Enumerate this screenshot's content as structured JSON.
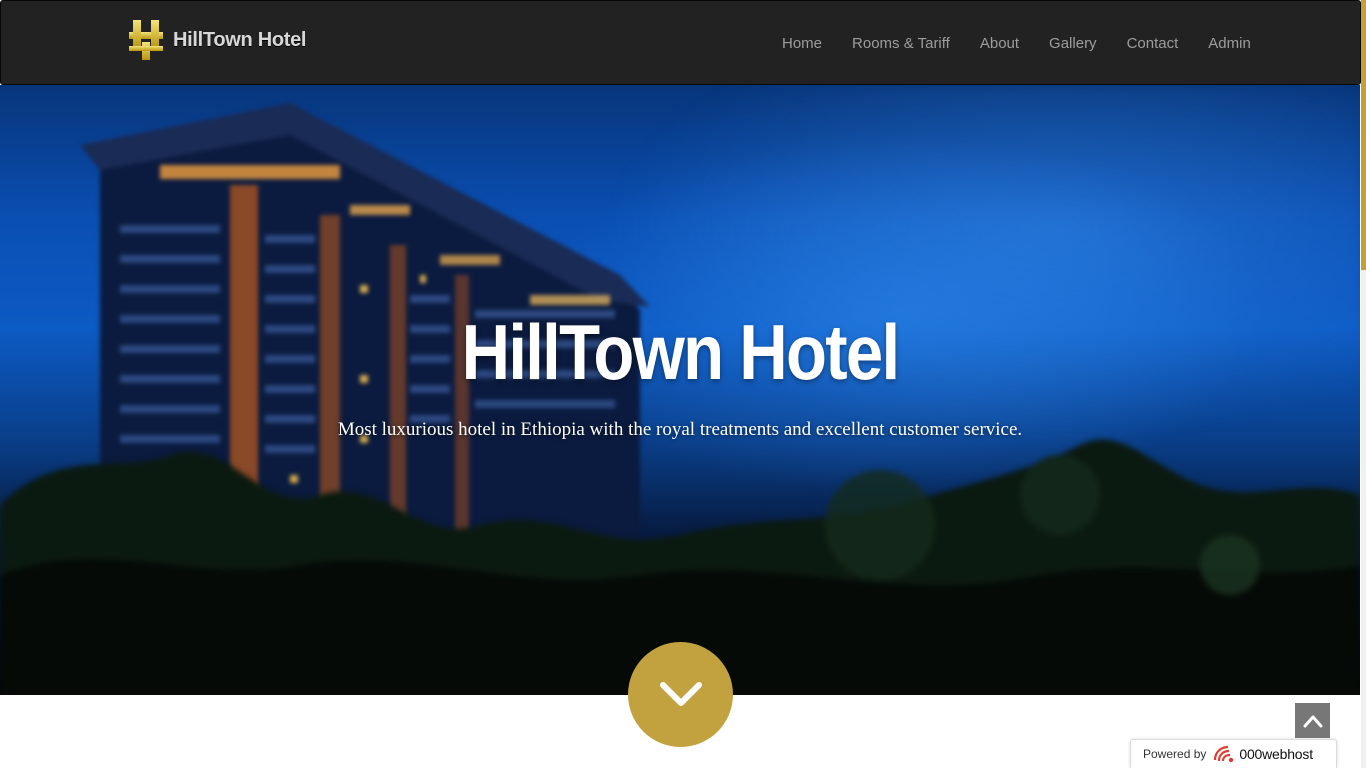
{
  "navbar": {
    "brand": "HillTown Hotel",
    "brand_logo_icon": "hotel-logo-icon",
    "links": [
      {
        "label": "Home"
      },
      {
        "label": "Rooms & Tariff"
      },
      {
        "label": "About"
      },
      {
        "label": "Gallery"
      },
      {
        "label": "Contact"
      },
      {
        "label": "Admin"
      }
    ]
  },
  "hero": {
    "title": "HillTown Hotel",
    "subtitle": "Most luxurious hotel in Ethiopia with the royal treatments and excellent customer service.",
    "scroll_icon": "chevron-down-icon"
  },
  "back_to_top_icon": "chevron-up-icon",
  "powered": {
    "label": "Powered by",
    "brand": "000webhost"
  },
  "colors": {
    "navbar_bg": "#222222",
    "nav_link": "#9d9d9d",
    "accent_gold": "#c2a23f",
    "hero_text": "#ffffff"
  }
}
